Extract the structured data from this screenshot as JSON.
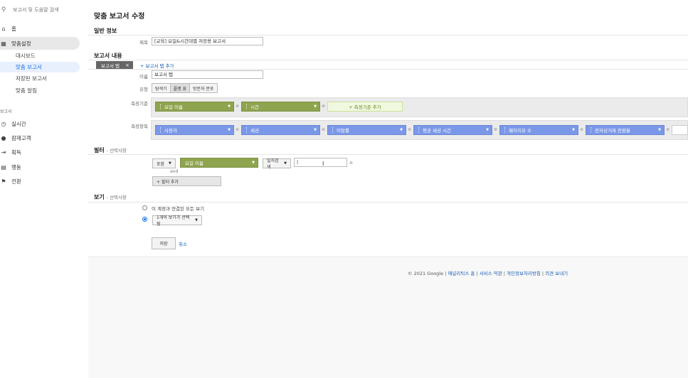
{
  "sidebar": {
    "search_placeholder": "보고서 및 도움말 검색",
    "home": "홈",
    "customization": "맞춤설정",
    "sub_items": [
      "대시보드",
      "맞춤 보고서",
      "저장된 보고서",
      "맞춤 알림"
    ],
    "reports_section": "보고서",
    "reports": [
      {
        "label": "실시간",
        "icon": "clock-icon"
      },
      {
        "label": "잠재고객",
        "icon": "person-icon"
      },
      {
        "label": "획득",
        "icon": "acquisition-icon"
      },
      {
        "label": "행동",
        "icon": "behavior-icon"
      },
      {
        "label": "전환",
        "icon": "flag-icon"
      }
    ]
  },
  "page": {
    "title": "맞춤 보고서 수정",
    "general_info": "일반 정보",
    "title_label": "제목",
    "title_value": "[교육] 요일&시간대별 저장용 보고서",
    "report_content": "보고서 내용",
    "report_tab_chip": "보고서 탭",
    "add_tab_link": "+ 보고서 탭 추가",
    "name_label": "이름",
    "name_value": "보고서 탭",
    "type_label": "유형",
    "types": [
      "탐색기",
      "플랫 표",
      "방문자 분포"
    ],
    "selected_type": "플랫 표",
    "dimensions_label": "측정기준",
    "dimensions": [
      "요일 이름",
      "시간"
    ],
    "add_dimension": "+ 측정기준 추가",
    "metrics_label": "측정항목",
    "metrics": [
      "사용자",
      "세션",
      "이탈률",
      "평균 세션 시간",
      "페이지뷰 수",
      "전자상거래 전환율"
    ],
    "filter_heading": "필터",
    "filter_optional": "- 선택사항",
    "filter_include": "포함",
    "filter_dimension": "요일 이름",
    "filter_match": "일치검색",
    "filter_value": "|",
    "filter_and": "and",
    "add_filter": "+ 필터 추가",
    "views_heading": "보기",
    "views_optional": "- 선택사항",
    "view_option_all": "이 계정과 연결된 모든 보기",
    "view_option_selected": "1개의 보기가 선택됨",
    "save": "저장",
    "cancel": "취소"
  },
  "footer": {
    "copyright": "© 2021 Google",
    "links": [
      "애널리틱스 홈",
      "서비스 약관",
      "개인정보처리방침",
      "의견 보내기"
    ]
  },
  "colors": {
    "dimension": "#8fa44f",
    "metric": "#7b98e8",
    "link": "#1a5fb4"
  }
}
